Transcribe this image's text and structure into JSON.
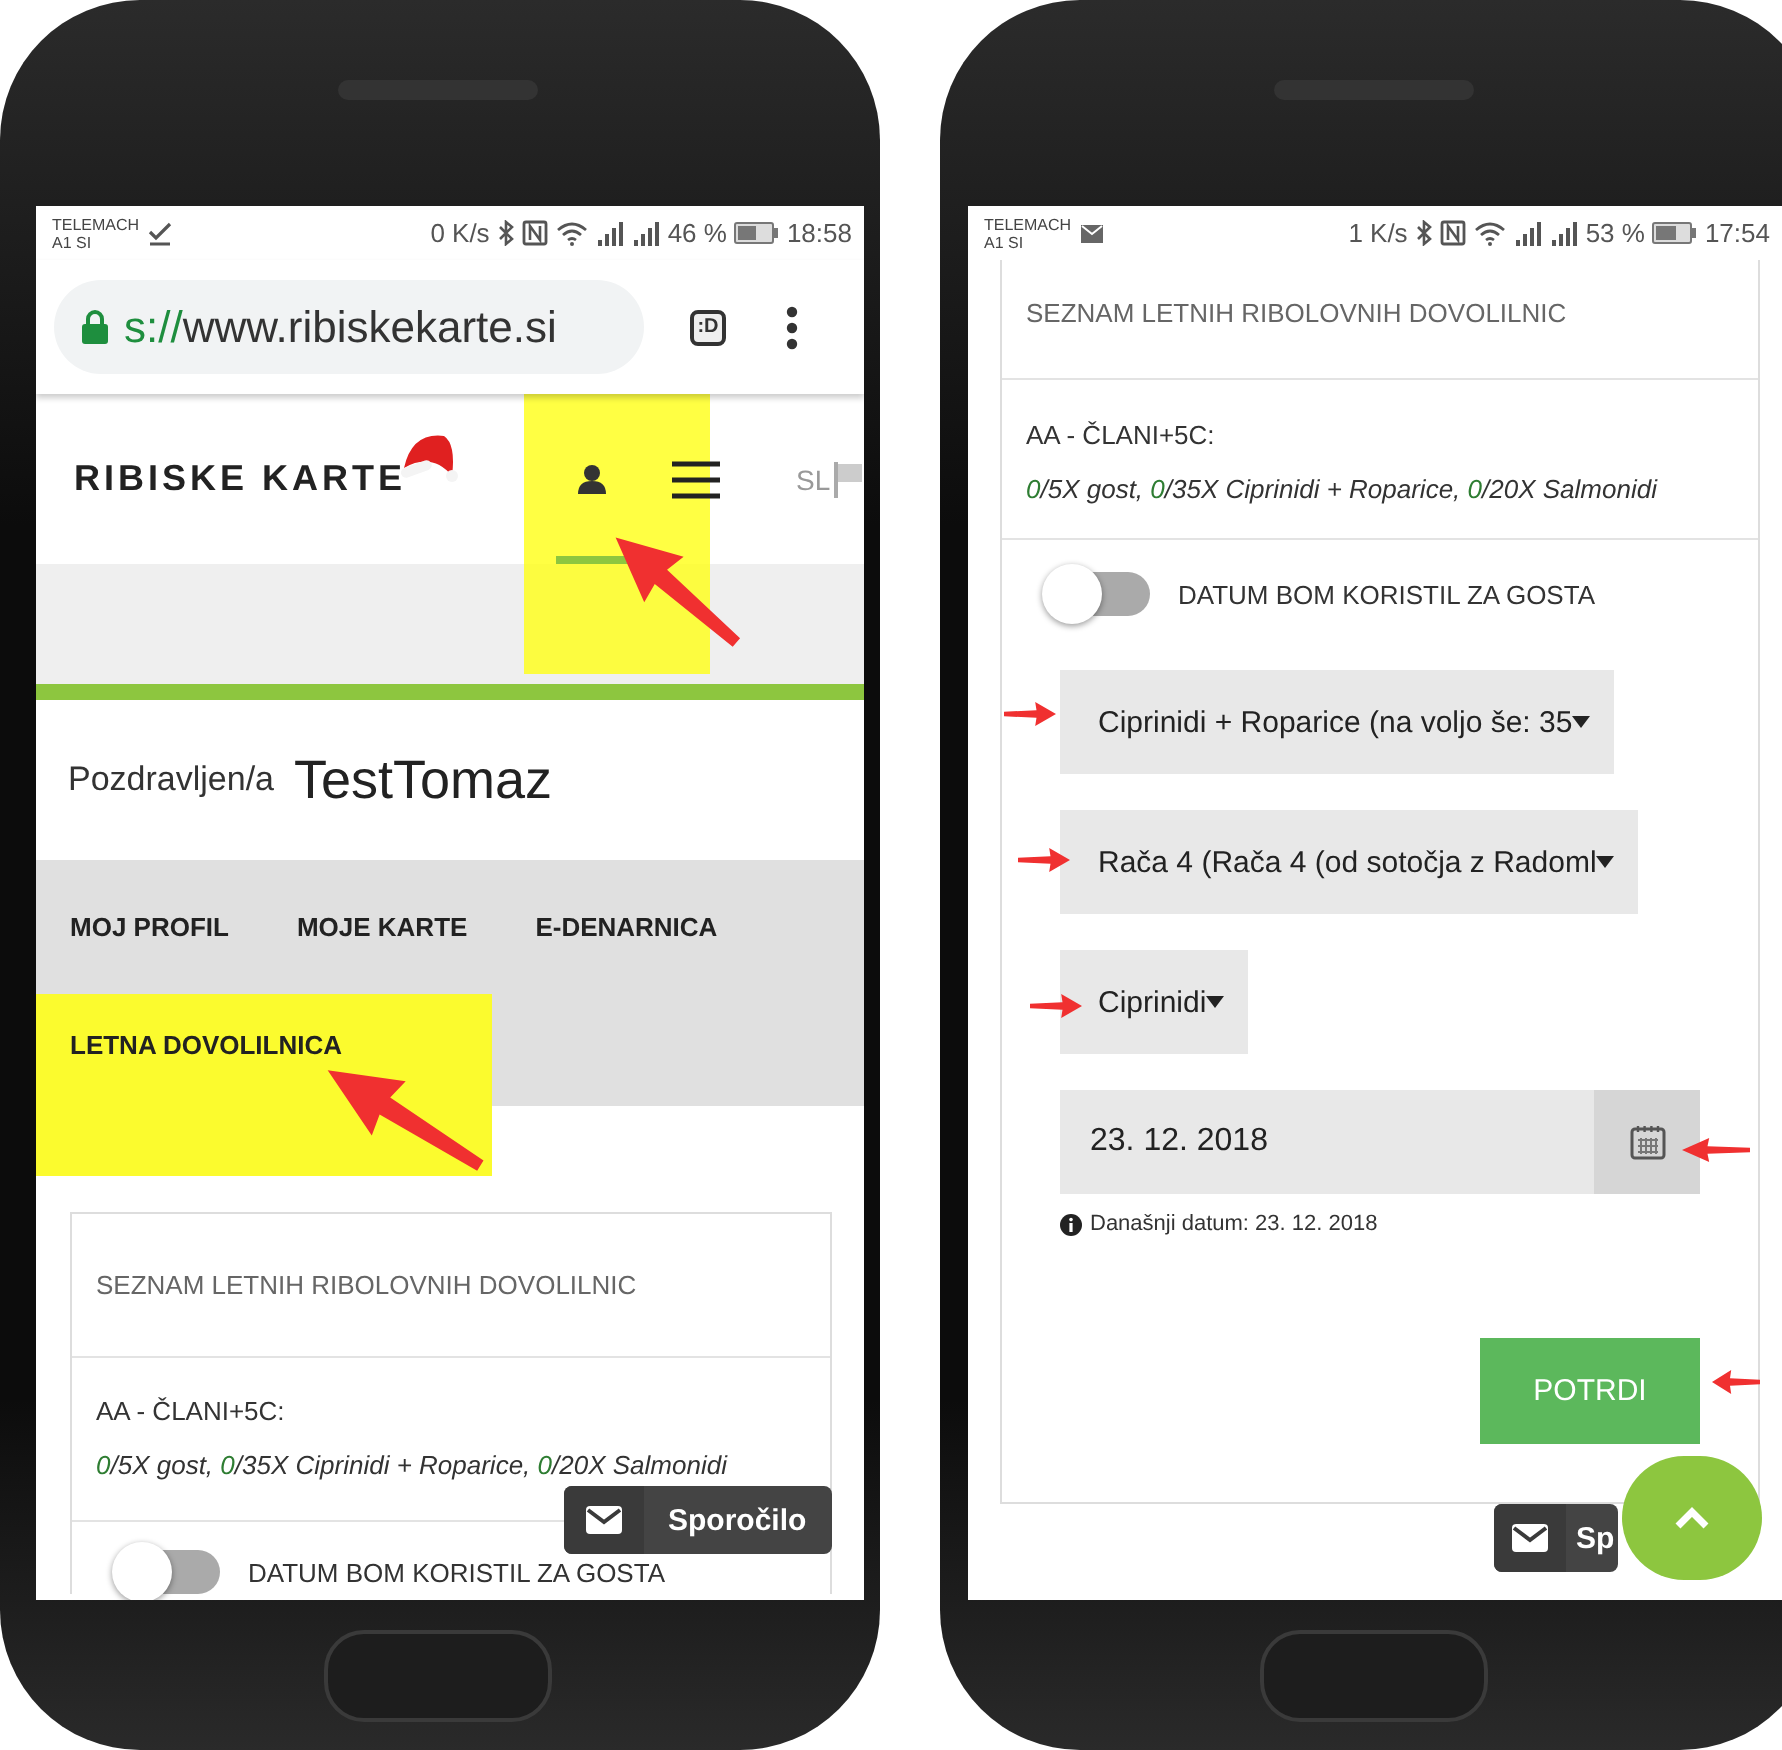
{
  "phones": [
    {
      "kind": "home",
      "status_bar": {
        "carrier": "TELEMACH",
        "network": "A1 SI",
        "speed": "0 K/s",
        "battery": "46 %",
        "time": "18:58"
      },
      "browser": {
        "scheme": "s://",
        "host": "www.ribiskekarte.si",
        "tab_switcher": ":D"
      },
      "header": {
        "logo": "RIBISKE KARTE",
        "language": "SL"
      },
      "greeting": {
        "label": "Pozdravljen/a",
        "name": "TestTomaz"
      },
      "nav": [
        {
          "label": "MOJ PROFIL",
          "highlighted": false
        },
        {
          "label": "MOJE KARTE",
          "highlighted": false
        },
        {
          "label": "E-DENARNICA",
          "highlighted": false
        },
        {
          "label": "LETNA DOVOLILNICA",
          "highlighted": true
        }
      ],
      "card": {
        "title": "SEZNAM LETNIH RIBOLOVNIH DOVOLILNIC",
        "permit": "AA - ČLANI+5C:",
        "quota": [
          {
            "used": "0",
            "rest": "/5X gost, "
          },
          {
            "used": "0",
            "rest": "/35X Ciprinidi + Roparice, "
          },
          {
            "used": "0",
            "rest": "/20X Salmonidi"
          }
        ],
        "toggle": {
          "label": "DATUM BOM KORISTIL ZA GOSTA",
          "on": false
        }
      },
      "message_button": "Sporočilo"
    },
    {
      "kind": "form",
      "status_bar": {
        "carrier": "TELEMACH",
        "network": "A1 SI",
        "speed": "1 K/s",
        "battery": "53 %",
        "time": "17:54"
      },
      "card": {
        "title": "SEZNAM LETNIH RIBOLOVNIH DOVOLILNIC",
        "permit": "AA - ČLANI+5C:",
        "quota": [
          {
            "used": "0",
            "rest": "/5X gost, "
          },
          {
            "used": "0",
            "rest": "/35X Ciprinidi + Roparice, "
          },
          {
            "used": "0",
            "rest": "/20X Salmonidi"
          }
        ],
        "toggle": {
          "label": "DATUM BOM KORISTIL ZA GOSTA",
          "on": false
        },
        "selects": [
          {
            "value": "Ciprinidi + Roparice (na voljo še: 35"
          },
          {
            "value": "Rača 4 (Rača 4 (od sotočja z Radoml"
          },
          {
            "value": "Ciprinidi"
          }
        ],
        "date_field": {
          "value": "23. 12. 2018"
        },
        "info": "Današnji datum: 23. 12. 2018",
        "submit": "POTRDI"
      },
      "message_button": "Sp"
    }
  ]
}
